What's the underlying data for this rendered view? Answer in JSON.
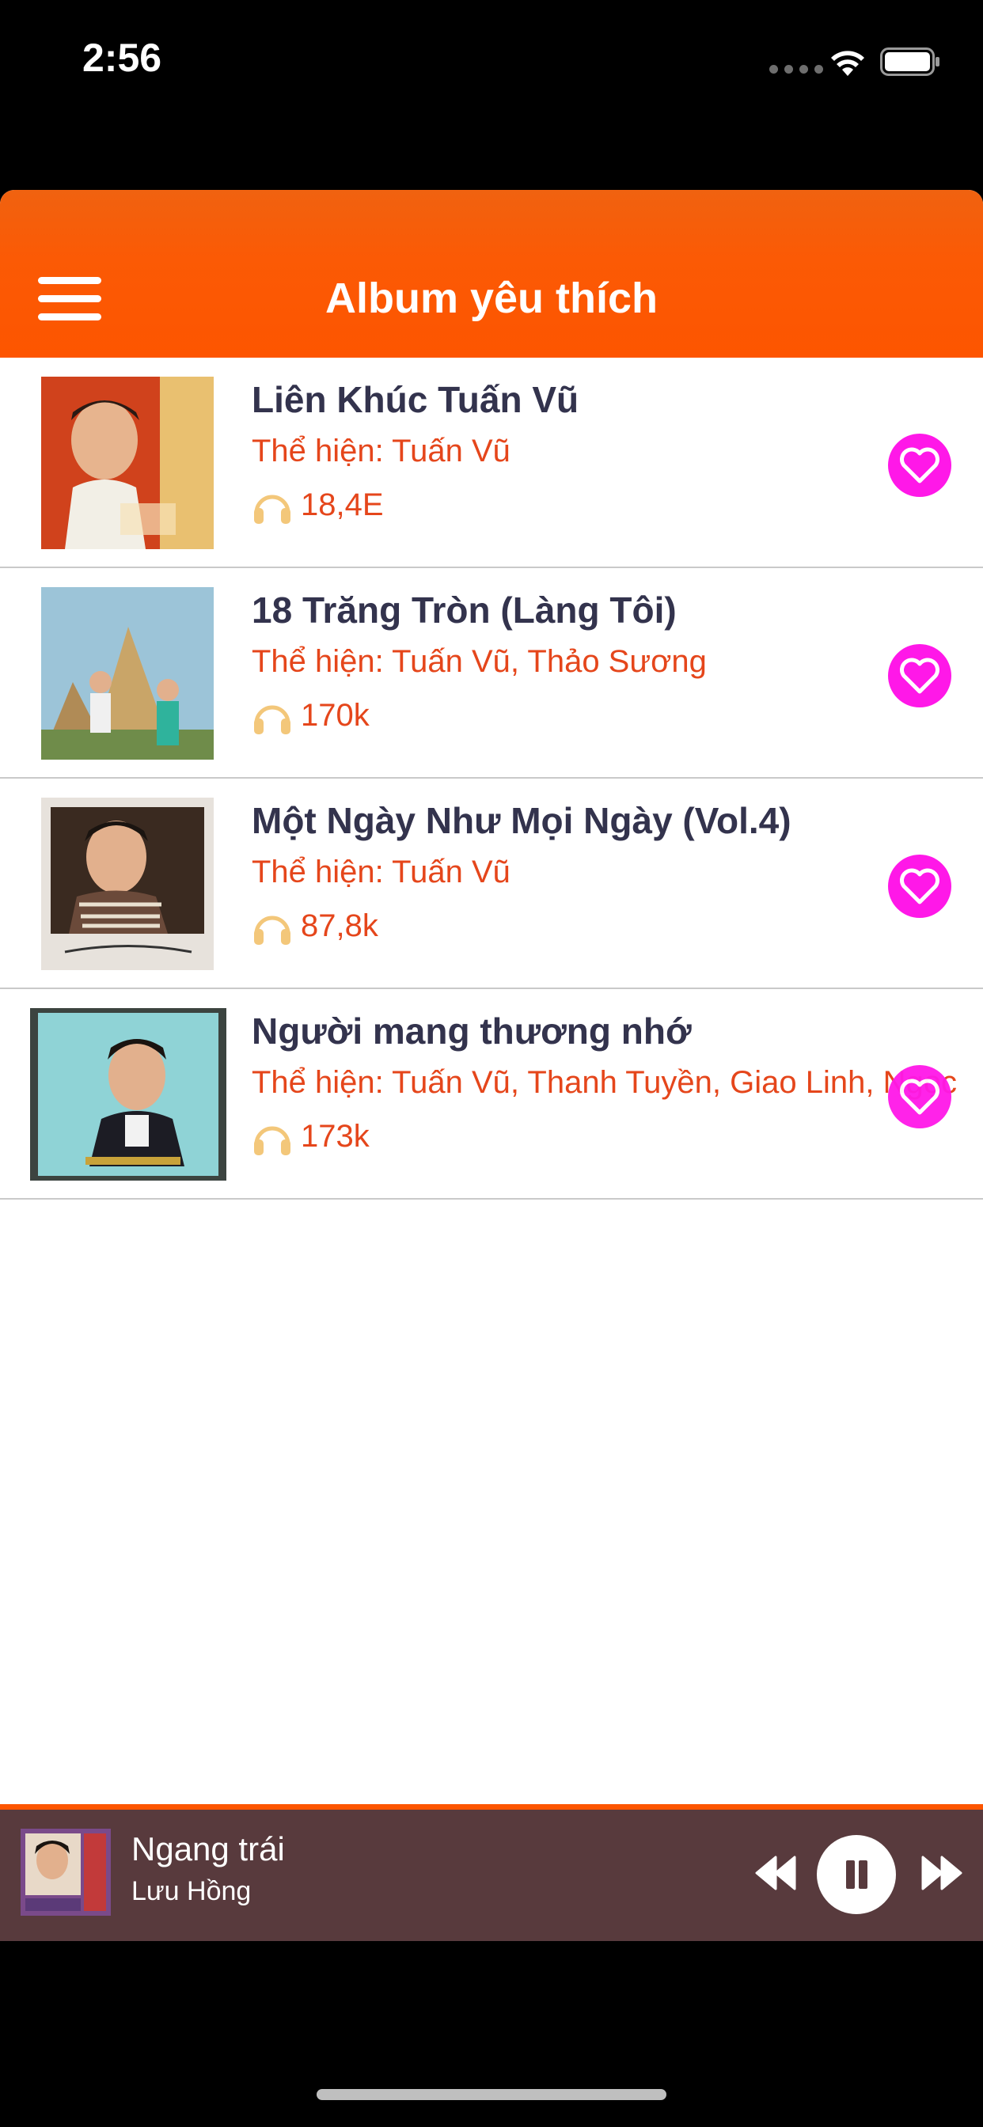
{
  "status": {
    "time": "2:56"
  },
  "header": {
    "title": "Album yêu thích"
  },
  "albums": [
    {
      "title": "Liên Khúc Tuấn Vũ",
      "artist": "Thể hiện:  Tuấn Vũ",
      "plays": "18,4E"
    },
    {
      "title": "18 Trăng Tròn (Làng Tôi)",
      "artist": "Thể hiện:  Tuấn Vũ, Thảo Sương",
      "plays": "170k"
    },
    {
      "title": "Một Ngày Như Mọi Ngày (Vol.4)",
      "artist": "Thể hiện:  Tuấn Vũ",
      "plays": "87,8k"
    },
    {
      "title": "Người mang thương nhớ",
      "artist": "Thể hiện: Tuấn Vũ, Thanh Tuyền, Giao Linh, Ngọc",
      "plays": "173k"
    }
  ],
  "player": {
    "title": "Ngang trái",
    "artist": "Lưu Hồng"
  },
  "colors": {
    "accent": "#fd5500",
    "favorite": "#ff18e8",
    "title_text": "#33334d",
    "detail_text": "#e5461b",
    "player_bg": "#583a3d"
  },
  "icons": [
    "menu-icon",
    "headphone-icon",
    "heart-icon",
    "previous-icon",
    "pause-icon",
    "next-icon",
    "wifi-icon",
    "battery-icon"
  ]
}
